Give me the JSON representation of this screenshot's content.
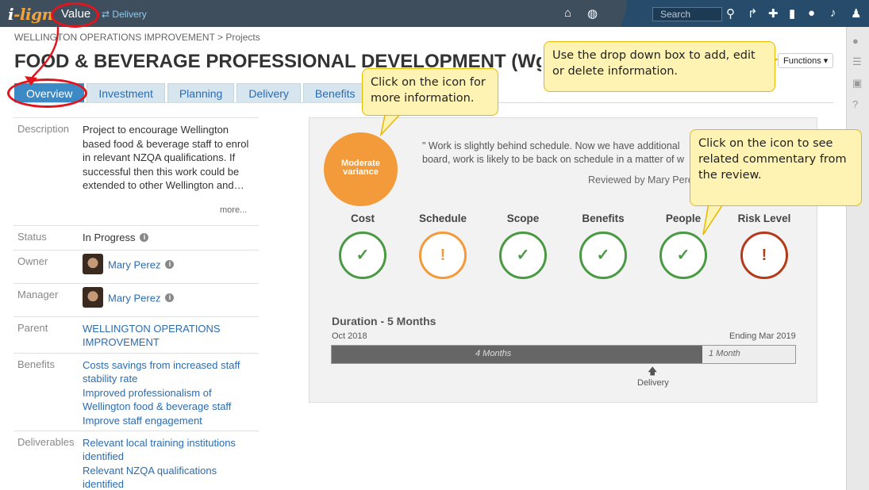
{
  "topbar": {
    "logo_prefix": "i",
    "logo_rest": "-lign",
    "module": "Value",
    "switch_link": "Delivery",
    "search_placeholder": "Search"
  },
  "breadcrumb": "WELLINGTON OPERATIONS IMPROVEMENT > Projects",
  "page_title": "FOOD & BEVERAGE PROFESSIONAL DEVELOPMENT (Wgtn",
  "functions_label": "Functions ▾",
  "tabs": [
    "Overview",
    "Investment",
    "Planning",
    "Delivery",
    "Benefits"
  ],
  "details": {
    "description_label": "Description",
    "description": "Project to encourage Wellington based food & beverage staff to enrol in relevant NZQA qualifications. If successful then this work could be extended to other Wellington and…",
    "more": "more...",
    "status_label": "Status",
    "status": "In Progress",
    "owner_label": "Owner",
    "owner": "Mary Perez",
    "manager_label": "Manager",
    "manager": "Mary Perez",
    "parent_label": "Parent",
    "parent": "WELLINGTON OPERATIONS IMPROVEMENT",
    "benefits_label": "Benefits",
    "benefits": [
      "Costs savings from increased staff stability rate",
      "Improved professionalism of Wellington food & beverage staff",
      "Improve staff engagement"
    ],
    "deliverables_label": "Deliverables",
    "deliverables": [
      "Relevant local training institutions identified",
      "Relevant NZQA qualifications identified"
    ]
  },
  "status_panel": {
    "variance": "Moderate variance",
    "quote_line1": "\" Work is slightly behind schedule. Now we have additional",
    "quote_line2": "board, work is likely to be back on schedule in a matter of w",
    "reviewed": "Reviewed by Mary Perez",
    "metrics": [
      {
        "label": "Cost",
        "state": "ok"
      },
      {
        "label": "Schedule",
        "state": "warning"
      },
      {
        "label": "Scope",
        "state": "ok"
      },
      {
        "label": "Benefits",
        "state": "ok"
      },
      {
        "label": "People",
        "state": "ok"
      },
      {
        "label": "Risk Level",
        "state": "danger"
      }
    ],
    "duration_title": "Duration - 5 Months",
    "start": "Oct 2018",
    "end": "Ending Mar 2019",
    "seg1": "4 Months",
    "seg2": "1 Month",
    "progress_fraction": 0.8,
    "marker": "Delivery"
  },
  "callouts": {
    "dropdown": "Use the drop down box to add, edit or delete information.",
    "icon_info": "Click on the icon for more information.",
    "commentary": "Click on the icon to see related commentary from the review."
  },
  "colors": {
    "ok": "#4a9a44",
    "warning": "#f39a3a",
    "danger": "#b33a1a",
    "accent": "#3b8ac5"
  }
}
